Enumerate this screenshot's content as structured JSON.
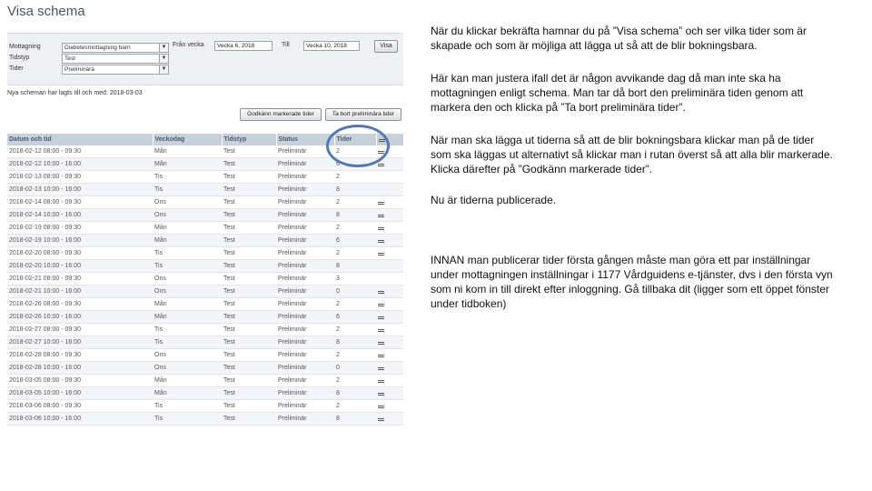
{
  "screen": {
    "title": "Visa schema",
    "filters": {
      "mottagning_label": "Mottagning",
      "mottagning_value": "Diabetesmottagning barn",
      "tidstyp_label": "Tidstyp",
      "tidstyp_value": "Test",
      "tider_label": "Tider",
      "tider_value": "Preliminära",
      "fran_vecka_label": "Från vecka",
      "fran_vecka_value": "Vecka 6, 2018",
      "till_label": "Till",
      "till_value": "Vecka 10, 2018",
      "visa_button": "Visa"
    },
    "saved_note": "Nya scheman har lagts till och med: 2018-03-03",
    "approve_button": "Godkänn markerade tider",
    "remove_button": "Ta bort preliminära tider",
    "columns": [
      "Datum och tid",
      "Veckodag",
      "Tidstyp",
      "Status",
      "Tider"
    ],
    "rows": [
      [
        "2018-02-12 08:00 - 09:30",
        "Mån",
        "Test",
        "Preliminär",
        "2",
        true
      ],
      [
        "2018-02-12 10:00 - 16:00",
        "Mån",
        "Test",
        "Preliminär",
        "6",
        true
      ],
      [
        "2018-02-13 08:00 - 09:30",
        "Tis",
        "Test",
        "Preliminär",
        "2",
        false
      ],
      [
        "2018-02-13 10:00 - 16:00",
        "Tis",
        "Test",
        "Preliminär",
        "8",
        false
      ],
      [
        "2018-02-14 08:00 - 09:30",
        "Ons",
        "Test",
        "Preliminär",
        "2",
        true
      ],
      [
        "2018-02-14 10:00 - 16:00",
        "Ons",
        "Test",
        "Preliminär",
        "8",
        true
      ],
      [
        "2018-02-19 08:00 - 09:30",
        "Mån",
        "Test",
        "Preliminär",
        "2",
        true
      ],
      [
        "2018-02-19 10:00 - 16:00",
        "Mån",
        "Test",
        "Preliminär",
        "6",
        true
      ],
      [
        "2018-02-20 08:00 - 09:30",
        "Tis",
        "Test",
        "Preliminär",
        "2",
        true
      ],
      [
        "2018-02-20 10:00 - 16:00",
        "Tis",
        "Test",
        "Preliminär",
        "8",
        false
      ],
      [
        "2018-02-21 08:00 - 09:30",
        "Ons",
        "Test",
        "Preliminär",
        "3",
        false
      ],
      [
        "2018-02-21 10:00 - 16:00",
        "Ons",
        "Test",
        "Preliminär",
        "0",
        true
      ],
      [
        "2018-02-26 08:00 - 09:30",
        "Mån",
        "Test",
        "Preliminär",
        "2",
        true
      ],
      [
        "2018-02-26 10:00 - 16:00",
        "Mån",
        "Test",
        "Preliminär",
        "6",
        true
      ],
      [
        "2018-02-27 08:00 - 09:30",
        "Tis",
        "Test",
        "Preliminär",
        "2",
        true
      ],
      [
        "2018-02-27 10:00 - 16:00",
        "Tis",
        "Test",
        "Preliminär",
        "8",
        true
      ],
      [
        "2018-02-28 08:00 - 09:30",
        "Ons",
        "Test",
        "Preliminär",
        "2",
        true
      ],
      [
        "2018-02-28 10:00 - 16:00",
        "Ons",
        "Test",
        "Preliminär",
        "0",
        true
      ],
      [
        "2018-03-05 08:00 - 09:30",
        "Mån",
        "Test",
        "Preliminär",
        "2",
        true
      ],
      [
        "2018-03-05 10:00 - 16:00",
        "Mån",
        "Test",
        "Preliminär",
        "8",
        true
      ],
      [
        "2018-03-06 08:00 - 09:30",
        "Tis",
        "Test",
        "Preliminär",
        "2",
        true
      ],
      [
        "2018-03-06 10:00 - 16:00",
        "Tis",
        "Test",
        "Preliminär",
        "8",
        true
      ]
    ]
  },
  "instructions": {
    "p1": "När du klickar bekräfta hamnar du på ”Visa schema” och ser vilka tider som är skapade och som är möjliga att lägga ut så att de blir bokningsbara.",
    "p2": "Här kan man justera ifall det är någon avvikande dag då man inte ska ha mottagningen enligt schema. Man tar då bort den preliminära tiden genom att markera den och klicka på ”Ta bort preliminära tider”.",
    "p3": "När man ska lägga ut tiderna så att de blir bokningsbara klickar man på de tider som ska läggas ut alternativt så klickar man i rutan överst så att alla blir markerade. Klicka därefter på ”Godkänn markerade tider”.",
    "p4": "Nu är tiderna publicerade.",
    "p5": "INNAN man publicerar tider första gången måste man göra ett par inställningar under mottagningen inställningar i 1177 Vårdguidens e-tjänster, dvs i den första vyn som ni kom in till direkt efter inloggning. Gå tillbaka dit (ligger som ett öppet fönster under tidboken)"
  },
  "colors": {
    "highlight_ring": "#5578b0",
    "header_bg": "#c8d0da",
    "header_text": "#4a5a70"
  },
  "icons": [
    "chevron-down-icon",
    "checkbox-icon"
  ]
}
